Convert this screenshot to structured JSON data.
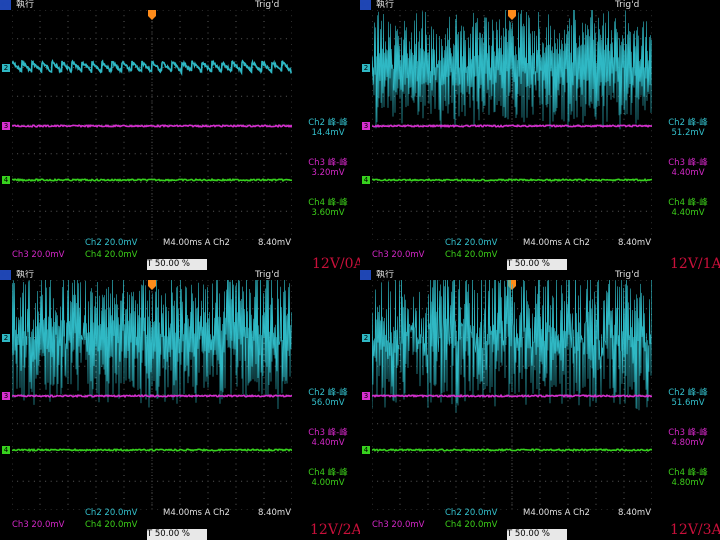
{
  "colors": {
    "ch2": "#2fb8c4",
    "ch3": "#d62fd0",
    "ch4": "#37d11e",
    "grid": "#5a5a5a",
    "condition": "#c8103a"
  },
  "icons": {
    "trigger_marker": "trigger-t-icon",
    "run_badge": "tek-logo-icon"
  },
  "panels": [
    {
      "run_state": "執行",
      "trig_state": "Trig'd",
      "meas": [
        {
          "label": "Ch2 峰-峰",
          "value": "14.4mV"
        },
        {
          "label": "Ch3 峰-峰",
          "value": "3.20mV"
        },
        {
          "label": "Ch4 峰-峰",
          "value": "3.60mV"
        }
      ],
      "ch2_scale": "Ch2  20.0mV",
      "ch3_scale": "Ch3  20.0mV",
      "ch4_scale": "Ch4  20.0mV",
      "timebase": "M4.00ms  A  Ch2",
      "trig_level": "8.40mV",
      "trig_pos": "T 50.00 %",
      "condition": "12V/0A",
      "ch2_amplitude": 0.08,
      "ch2_density": 0.3
    },
    {
      "run_state": "執行",
      "trig_state": "Trig'd",
      "meas": [
        {
          "label": "Ch2 峰-峰",
          "value": "51.2mV"
        },
        {
          "label": "Ch3 峰-峰",
          "value": "4.40mV"
        },
        {
          "label": "Ch4 峰-峰",
          "value": "4.40mV"
        }
      ],
      "ch2_scale": "Ch2  20.0mV",
      "ch3_scale": "Ch3  20.0mV",
      "ch4_scale": "Ch4  20.0mV",
      "timebase": "M4.00ms  A  Ch2",
      "trig_level": "8.40mV",
      "trig_pos": "T 50.00 %",
      "condition": "12V/1A",
      "ch2_amplitude": 0.35,
      "ch2_density": 0.6
    },
    {
      "run_state": "執行",
      "trig_state": "Trig'd",
      "meas": [
        {
          "label": "Ch2 峰-峰",
          "value": "56.0mV"
        },
        {
          "label": "Ch3 峰-峰",
          "value": "4.40mV"
        },
        {
          "label": "Ch4 峰-峰",
          "value": "4.00mV"
        }
      ],
      "ch2_scale": "Ch2  20.0mV",
      "ch3_scale": "Ch3  20.0mV",
      "ch4_scale": "Ch4  20.0mV",
      "timebase": "M4.00ms  A  Ch2",
      "trig_level": "8.40mV",
      "trig_pos": "T 50.00 %",
      "condition": "12V/2A",
      "ch2_amplitude": 0.38,
      "ch2_density": 0.7
    },
    {
      "run_state": "執行",
      "trig_state": "Trig'd",
      "meas": [
        {
          "label": "Ch2 峰-峰",
          "value": "51.6mV"
        },
        {
          "label": "Ch3 峰-峰",
          "value": "4.80mV"
        },
        {
          "label": "Ch4 峰-峰",
          "value": "4.80mV"
        }
      ],
      "ch2_scale": "Ch2  20.0mV",
      "ch3_scale": "Ch3  20.0mV",
      "ch4_scale": "Ch4  20.0mV",
      "timebase": "M4.00ms  A  Ch2",
      "trig_level": "8.40mV",
      "trig_pos": "T 50.00 %",
      "condition": "12V/3A",
      "ch2_amplitude": 0.34,
      "ch2_density": 1.0
    }
  ]
}
